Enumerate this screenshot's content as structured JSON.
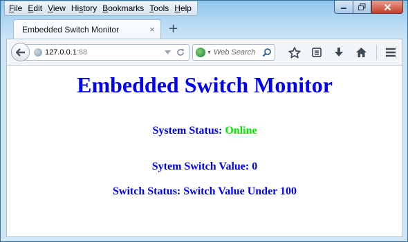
{
  "menu": [
    {
      "u": "F",
      "rest": "ile"
    },
    {
      "u": "E",
      "rest": "dit"
    },
    {
      "u": "V",
      "rest": "iew"
    },
    {
      "pre": "Hi",
      "u": "s",
      "rest": "tory"
    },
    {
      "u": "B",
      "rest": "ookmarks"
    },
    {
      "u": "T",
      "rest": "ools"
    },
    {
      "u": "H",
      "rest": "elp"
    }
  ],
  "tab": {
    "title": "Embedded Switch Monitor",
    "close": "×"
  },
  "new_tab": "+",
  "url": {
    "host": "127.0.0.1",
    "port": ":88"
  },
  "search": {
    "placeholder": "Web Search"
  },
  "page": {
    "heading": "Embedded Switch Monitor",
    "system_status_label": "System Status: ",
    "system_status_value": "Online",
    "switch_value_label": "Sytem Switch Value: ",
    "switch_value": "0",
    "switch_status_label": "Switch Status: ",
    "switch_status_value": "Switch Value Under 100"
  },
  "colors": {
    "heading": "#0000ee",
    "online": "#00ee00"
  },
  "icons": [
    "back-arrow-icon",
    "globe-icon",
    "dropdown-arrow-icon",
    "reload-icon",
    "search-engine-icon",
    "magnifier-icon",
    "star-icon",
    "reading-list-icon",
    "download-icon",
    "home-icon",
    "menu-icon"
  ]
}
